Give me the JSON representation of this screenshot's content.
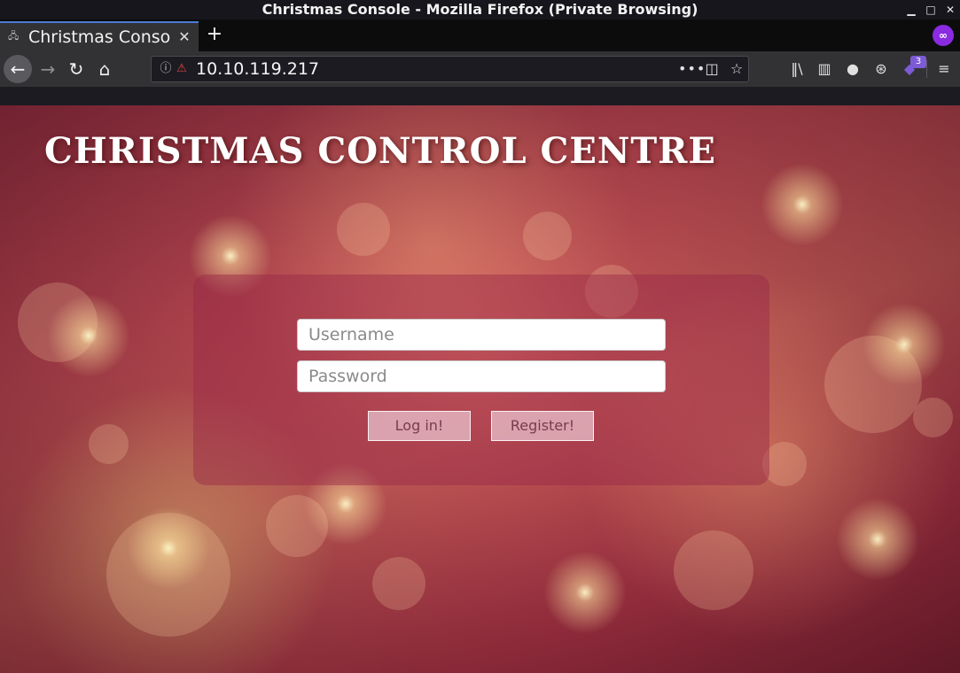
{
  "window": {
    "title": "Christmas Console - Mozilla Firefox (Private Browsing)",
    "minimize": "▁",
    "maximize": "□",
    "close": "✕"
  },
  "tab": {
    "title": "Christmas Conso",
    "favicon": "🖧",
    "close": "✕",
    "new_tab": "+"
  },
  "toolbar": {
    "back": "←",
    "forward": "→",
    "reload": "↻",
    "home": "⌂",
    "info": "ⓘ",
    "insecure": "⚠",
    "url": "10.10.119.217",
    "page_actions": "•••",
    "pocket": "◫",
    "bookmark": "☆",
    "library": "‖\\",
    "sidebar": "▥",
    "account": "●",
    "network": "⊛",
    "extension": "◆",
    "extension_badge": "3",
    "menu": "≡",
    "private": "∞"
  },
  "page": {
    "heading": "CHRISTMAS CONTROL CENTRE",
    "login": {
      "username_placeholder": "Username",
      "password_placeholder": "Password",
      "login_label": "Log in!",
      "register_label": "Register!"
    }
  },
  "colors": {
    "tab_accent": "#4b7bd6",
    "private_badge": "#8a2be2",
    "background_red": "#c9505a"
  }
}
